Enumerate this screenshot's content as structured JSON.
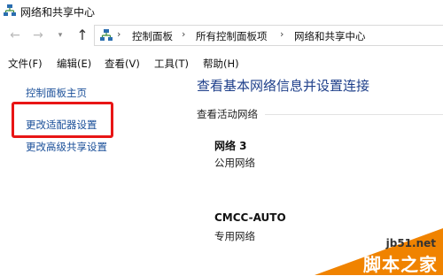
{
  "window": {
    "title": "网络和共享中心"
  },
  "nav": {
    "back_icon": "←",
    "forward_icon": "→",
    "dropdown_icon": "▾",
    "up_icon": "↑"
  },
  "breadcrumb": {
    "separator": "›",
    "items": [
      "控制面板",
      "所有控制面板项",
      "网络和共享中心"
    ]
  },
  "menu": {
    "items": [
      "文件(F)",
      "编辑(E)",
      "查看(V)",
      "工具(T)",
      "帮助(H)"
    ]
  },
  "sidebar": {
    "items": [
      "控制面板主页",
      "更改适配器设置",
      "更改高级共享设置"
    ]
  },
  "main": {
    "heading": "查看基本网络信息并设置连接",
    "active_networks_title": "查看活动网络",
    "networks": [
      {
        "name": "网络  3",
        "type": "公用网络"
      },
      {
        "name": "CMCC-AUTO",
        "type": "专用网络"
      }
    ]
  },
  "watermark": {
    "url": "jb51.net",
    "name": "脚本之家"
  },
  "colors": {
    "link": "#1a4f99",
    "heading": "#1e3f8a",
    "highlight": "#e81515",
    "watermark": "#f08300"
  }
}
